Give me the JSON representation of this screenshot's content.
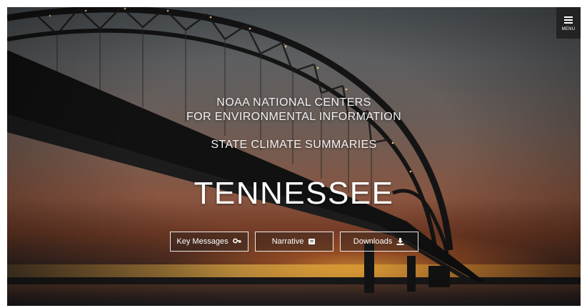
{
  "menu": {
    "label": "MENU",
    "icon": "hamburger-icon"
  },
  "hero": {
    "org_line1": "NOAA NATIONAL CENTERS",
    "org_line2": "FOR ENVIRONMENTAL INFORMATION",
    "subtitle": "STATE CLIMATE SUMMARIES",
    "state": "TENNESSEE"
  },
  "buttons": [
    {
      "label": "Key Messages",
      "icon": "key-icon"
    },
    {
      "label": "Narrative",
      "icon": "book-icon"
    },
    {
      "label": "Downloads",
      "icon": "download-icon"
    }
  ],
  "background": {
    "description_icon": "bridge-sunset-photo"
  },
  "colors": {
    "text": "#ffffff",
    "menu_bg": "#232323"
  }
}
